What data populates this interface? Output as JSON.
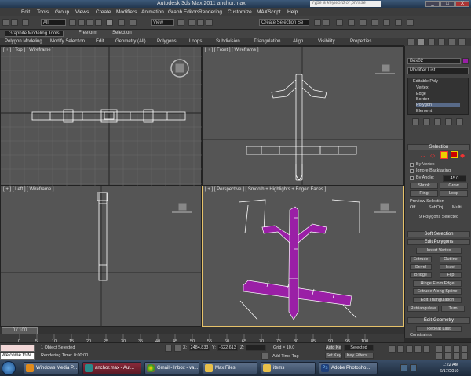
{
  "window": {
    "title": "Autodesk 3ds Max 2011      anchor.max",
    "help_placeholder": "Type a keyword or phrase",
    "min": "_",
    "max": "□",
    "close": "X"
  },
  "menubar": [
    "Edit",
    "Tools",
    "Group",
    "Views",
    "Create",
    "Modifiers",
    "Animation",
    "Graph Editors",
    "Rendering",
    "Customize",
    "MAXScript",
    "Help"
  ],
  "toolbar": {
    "filter_all": "All",
    "view": "View",
    "selection_set": "Create Selection Se"
  },
  "ribbon": {
    "tabs": [
      "Graphite Modeling Tools",
      "Freeform",
      "Selection"
    ],
    "panels": [
      "Polygon Modeling",
      "Modify Selection",
      "Edit",
      "Geometry (All)",
      "Polygons",
      "Loops",
      "Subdivision",
      "Triangulation",
      "Align",
      "Visibility",
      "Properties"
    ]
  },
  "viewports": {
    "top": "[ + ] [ Top ] [ Wireframe ]",
    "front": "[ + ] [ Front ] [ Wireframe ]",
    "left": "[ + ] [ Left ] [ Wireframe ]",
    "perspective": "[ + ] [ Perspective ] [ Smooth + Highlights + Edged Faces ]"
  },
  "command_panel": {
    "object_name": "Box02",
    "modifier_list": "Modifier List",
    "stack": [
      "Editable Poly",
      "Vertex",
      "Edge",
      "Border",
      "Polygon",
      "Element"
    ],
    "selection_header": "Selection",
    "by_vertex": "By Vertex",
    "ignore_backfacing": "Ignore Backfacing",
    "by_angle": "By Angle:",
    "by_angle_value": "45.0",
    "shrink": "Shrink",
    "grow": "Grow",
    "ring": "Ring",
    "loop": "Loop",
    "preview_selection": "Preview Selection",
    "preview_off": "Off",
    "preview_subobj": "SubObj",
    "preview_multi": "Multi",
    "selected_count": "9 Polygons Selected",
    "soft_selection": "Soft Selection",
    "edit_polygons": "Edit Polygons",
    "insert_vertex": "Insert Vertex",
    "extrude": "Extrude",
    "outline": "Outline",
    "bevel": "Bevel",
    "inset": "Inset",
    "bridge": "Bridge",
    "flip": "Flip",
    "hinge_from_edge": "Hinge From Edge",
    "extrude_along_spline": "Extrude Along Spline",
    "edit_triangulation": "Edit Triangulation",
    "retriangulate": "Retriangulate",
    "turn": "Turn",
    "edit_geometry": "Edit Geometry",
    "repeat_last": "Repeat Last",
    "constraints": "Constraints"
  },
  "timeline": {
    "frame": "0 / 100",
    "ticks": [
      "0",
      "5",
      "10",
      "15",
      "20",
      "25",
      "30",
      "35",
      "40",
      "45",
      "50",
      "55",
      "60",
      "65",
      "70",
      "75",
      "80",
      "85",
      "90",
      "95",
      "100"
    ]
  },
  "status": {
    "script_listener": "Welcome to M",
    "objects_selected": "1 Object Selected",
    "rendering_time": "Rendering Time: 0:00:00",
    "x_label": "X:",
    "x_value": "2484.833",
    "y_label": "Y:",
    "y_value": "-622.613",
    "z_label": "Z:",
    "z_value": "",
    "grid": "Grid = 10.0",
    "add_time_tag": "Add Time Tag",
    "auto_key": "Auto Key",
    "selected": "Selected",
    "set_key": "Set Key",
    "key_filters": "Key Filters..."
  },
  "taskbar": {
    "items": [
      "Windows Media P...",
      "anchor.max - Aut...",
      "Gmail - Inbox - va...",
      "Max Files",
      "items",
      "Adobe Photosho..."
    ],
    "time": "1:22 AM",
    "date": "6/17/2010"
  },
  "colors": {
    "selection": "#9a1fa6",
    "wire": "#ffffff",
    "active_border": "#e6c26a"
  }
}
